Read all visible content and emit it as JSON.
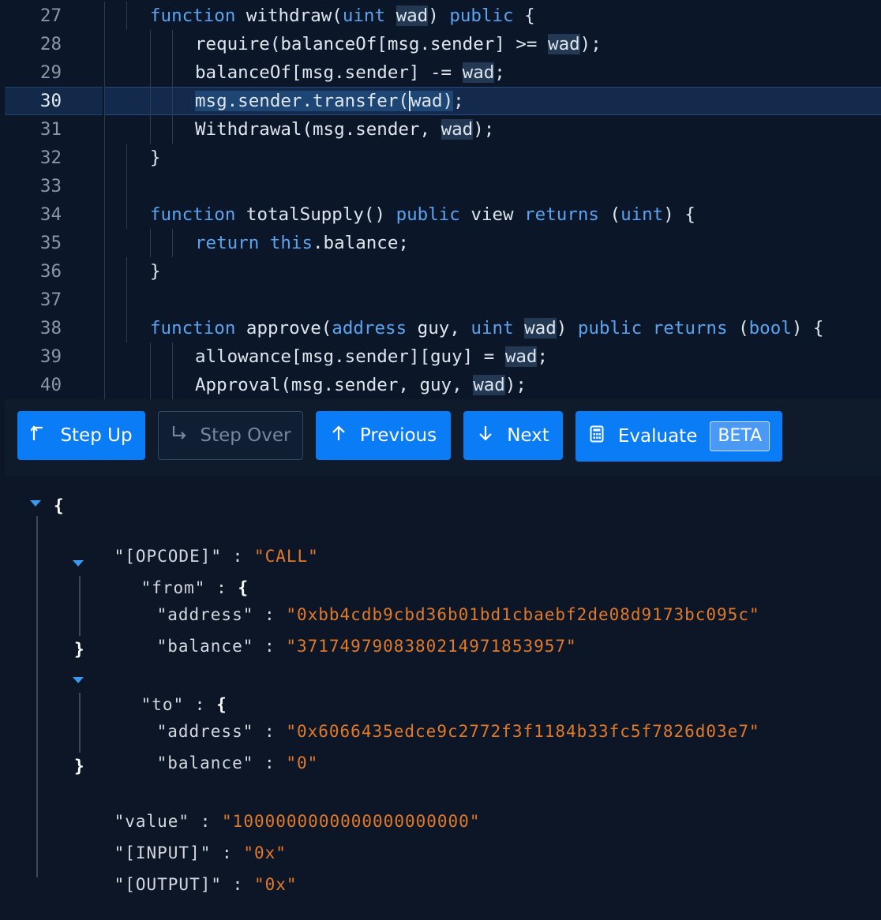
{
  "editor": {
    "lines": [
      {
        "num": "27",
        "parts": [
          [
            "kw",
            "function"
          ],
          [
            "t",
            " withdraw("
          ],
          [
            "kw",
            "uint"
          ],
          [
            "t",
            " "
          ],
          [
            "hl",
            "wad"
          ],
          [
            "t",
            ") "
          ],
          [
            "kw",
            "public"
          ],
          [
            "t",
            " {"
          ]
        ],
        "indent": 1
      },
      {
        "num": "28",
        "parts": [
          [
            "t",
            "require(balanceOf[msg.sender] >= "
          ],
          [
            "hl",
            "wad"
          ],
          [
            "t",
            ");"
          ]
        ],
        "indent": 2
      },
      {
        "num": "29",
        "parts": [
          [
            "t",
            "balanceOf[msg.sender] -= "
          ],
          [
            "hl",
            "wad"
          ],
          [
            "t",
            ";"
          ]
        ],
        "indent": 2
      },
      {
        "num": "30",
        "parts": [
          [
            "sel",
            "msg.sender.transfer("
          ],
          [
            "cur",
            "wad"
          ],
          [
            "sel",
            ")"
          ],
          [
            "t",
            ";"
          ]
        ],
        "indent": 2,
        "active": true
      },
      {
        "num": "31",
        "parts": [
          [
            "t",
            "Withdrawal(msg.sender, "
          ],
          [
            "hl",
            "wad"
          ],
          [
            "t",
            ");"
          ]
        ],
        "indent": 2
      },
      {
        "num": "32",
        "parts": [
          [
            "t",
            "}"
          ]
        ],
        "indent": 1
      },
      {
        "num": "33",
        "parts": [],
        "indent": 0
      },
      {
        "num": "34",
        "parts": [
          [
            "kw",
            "function"
          ],
          [
            "t",
            " totalSupply() "
          ],
          [
            "kw",
            "public"
          ],
          [
            "t",
            " view "
          ],
          [
            "kw",
            "returns"
          ],
          [
            "t",
            " ("
          ],
          [
            "kw",
            "uint"
          ],
          [
            "t",
            ") {"
          ]
        ],
        "indent": 1
      },
      {
        "num": "35",
        "parts": [
          [
            "kw",
            "return"
          ],
          [
            "t",
            " "
          ],
          [
            "kw",
            "this"
          ],
          [
            "t",
            ".balance;"
          ]
        ],
        "indent": 2
      },
      {
        "num": "36",
        "parts": [
          [
            "t",
            "}"
          ]
        ],
        "indent": 1
      },
      {
        "num": "37",
        "parts": [],
        "indent": 0
      },
      {
        "num": "38",
        "parts": [
          [
            "kw",
            "function"
          ],
          [
            "t",
            " approve("
          ],
          [
            "kw",
            "address"
          ],
          [
            "t",
            " guy, "
          ],
          [
            "kw",
            "uint"
          ],
          [
            "t",
            " "
          ],
          [
            "hl",
            "wad"
          ],
          [
            "t",
            ") "
          ],
          [
            "kw",
            "public"
          ],
          [
            "t",
            " "
          ],
          [
            "kw",
            "returns"
          ],
          [
            "t",
            " ("
          ],
          [
            "kw",
            "bool"
          ],
          [
            "t",
            ") {"
          ]
        ],
        "indent": 1
      },
      {
        "num": "39",
        "parts": [
          [
            "t",
            "allowance[msg.sender][guy] = "
          ],
          [
            "hl",
            "wad"
          ],
          [
            "t",
            ";"
          ]
        ],
        "indent": 2
      },
      {
        "num": "40",
        "parts": [
          [
            "t",
            "Approval(msg.sender, guy, "
          ],
          [
            "hl",
            "wad"
          ],
          [
            "t",
            ");"
          ]
        ],
        "indent": 2
      }
    ]
  },
  "toolbar": {
    "step_up": {
      "label": "Step Up",
      "icon": "step-up-arrow-icon"
    },
    "step_over": {
      "label": "Step Over",
      "icon": "step-over-arrow-icon"
    },
    "previous": {
      "label": "Previous",
      "icon": "arrow-up-icon"
    },
    "next": {
      "label": "Next",
      "icon": "arrow-down-icon"
    },
    "evaluate": {
      "label": "Evaluate",
      "badge": "BETA",
      "icon": "calculator-icon"
    }
  },
  "tree": {
    "open_brace": "{",
    "opcode_key": "\"[OPCODE]\"",
    "opcode_val": "\"CALL\"",
    "from_key": "\"from\"",
    "from_address_key": "\"address\"",
    "from_address_val": "\"0xbb4cdb9cbd36b01bd1cbaebf2de08d9173bc095c\"",
    "from_balance_key": "\"balance\"",
    "from_balance_val": "\"3717497908380214971853957\"",
    "to_key": "\"to\"",
    "to_address_key": "\"address\"",
    "to_address_val": "\"0x6066435edce9c2772f3f1184b33fc5f7826d03e7\"",
    "to_balance_key": "\"balance\"",
    "to_balance_val": "\"0\"",
    "value_key": "\"value\"",
    "value_val": "\"1000000000000000000000\"",
    "input_key": "\"[INPUT]\"",
    "input_val": "\"0x\"",
    "output_key": "\"[OUTPUT]\"",
    "output_val": "\"0x\"",
    "colon": " : ",
    "close_brace": "}"
  },
  "colors": {
    "accent": "#0a7cf6",
    "string": "#e07a2a",
    "keyword": "#5aa3f0",
    "background": "#0b1728"
  }
}
